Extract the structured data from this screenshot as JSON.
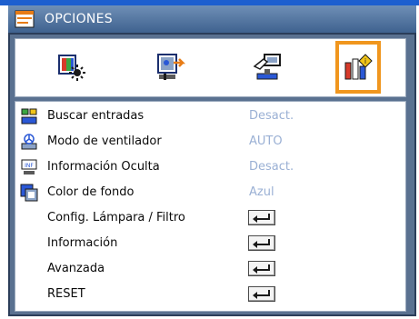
{
  "title": "OPCIONES",
  "tabs": [
    {
      "icon": "display-settings-icon",
      "selected": false
    },
    {
      "icon": "image-settings-icon",
      "selected": false
    },
    {
      "icon": "setup-icon",
      "selected": false
    },
    {
      "icon": "options-icon",
      "selected": true
    }
  ],
  "menu": {
    "items": [
      {
        "label": "Buscar entradas",
        "value": "Desact.",
        "icon": "source-search-icon"
      },
      {
        "label": "Modo de ventilador",
        "value": "AUTO",
        "icon": "fan-icon"
      },
      {
        "label": "Información Oculta",
        "value": "Desact.",
        "icon": "info-hide-icon"
      },
      {
        "label": "Color de fondo",
        "value": "Azul",
        "icon": "background-color-icon"
      },
      {
        "label": "Config. Lámpara / Filtro",
        "value": "",
        "icon": ""
      },
      {
        "label": "Información",
        "value": "",
        "icon": ""
      },
      {
        "label": "Avanzada",
        "value": "",
        "icon": ""
      },
      {
        "label": "RESET",
        "value": "",
        "icon": ""
      }
    ]
  },
  "colors": {
    "selection": "#f0961e",
    "value_text": "#9ab0d4",
    "frame": "#5a7190",
    "title_bar": "#4f729f"
  }
}
